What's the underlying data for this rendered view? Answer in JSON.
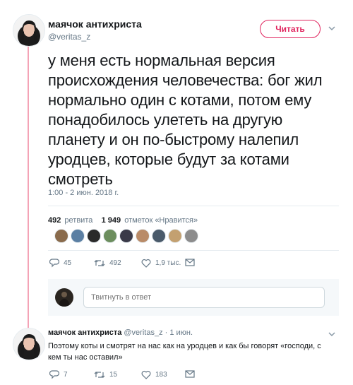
{
  "tweet": {
    "author_name": "маячок антихриста",
    "author_handle": "@veritas_z",
    "follow_label": "Читать",
    "text": "у меня есть нормальная версия происхождения человечества: бог жил нормально один с котами, потом ему понадобилось улететь на другую планету и он по-быстрому налепил уродцев, которые будут за котами смотреть",
    "timestamp": "1:00 - 2 июн. 2018 г.",
    "retweet_count": "492",
    "retweet_label": "ретвита",
    "like_count": "1 949",
    "like_label": "отметок «Нравится»",
    "actions": {
      "replies": "45",
      "retweets": "492",
      "likes": "1,9 тыс."
    }
  },
  "reply_composer": {
    "placeholder": "Твитнуть в ответ"
  },
  "reply": {
    "author_name": "маячок антихриста",
    "author_handle": "@veritas_z",
    "time": "· 1 июн.",
    "text": "Поэтому коты и смотрят на нас как на уродцев и как бы говорят «господи, с кем ты нас оставил»",
    "actions": {
      "replies": "7",
      "retweets": "15",
      "likes": "183"
    }
  },
  "colors": {
    "accent": "#e0245e",
    "thread_line": "#f4a3b6",
    "muted_text": "#657786",
    "icon": "#8899a6"
  },
  "icons": [
    "chevron-down-icon",
    "reply-icon",
    "retweet-icon",
    "heart-icon",
    "message-icon"
  ]
}
